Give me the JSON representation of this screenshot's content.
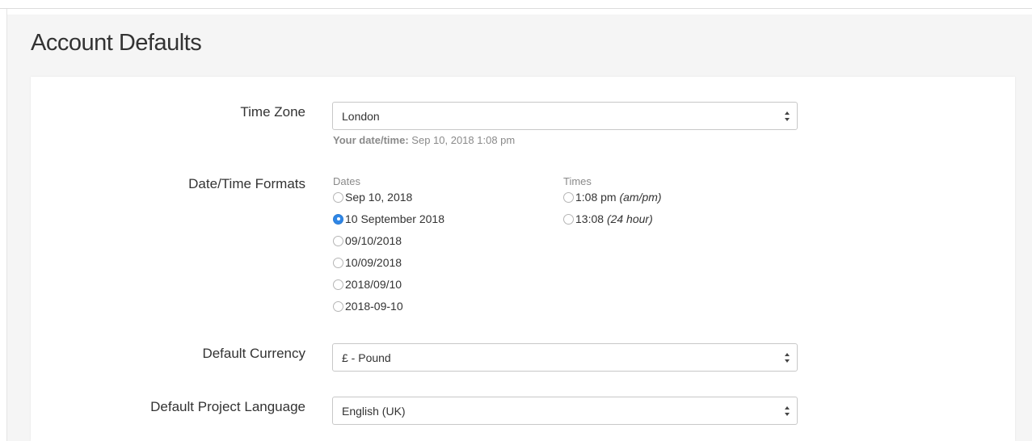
{
  "page": {
    "title": "Account Defaults"
  },
  "time_zone": {
    "label": "Time Zone",
    "selected": "London",
    "helper_label": "Your date/time:",
    "helper_value": "Sep 10, 2018 1:08 pm"
  },
  "date_time_formats": {
    "label": "Date/Time Formats",
    "dates": {
      "heading": "Dates",
      "options": [
        {
          "label": "Sep 10, 2018",
          "checked": false
        },
        {
          "label": "10 September 2018",
          "checked": true
        },
        {
          "label": "09/10/2018",
          "checked": false
        },
        {
          "label": "10/09/2018",
          "checked": false
        },
        {
          "label": "2018/09/10",
          "checked": false
        },
        {
          "label": "2018-09-10",
          "checked": false
        }
      ]
    },
    "times": {
      "heading": "Times",
      "options": [
        {
          "label": "1:08 pm",
          "note": "(am/pm)",
          "checked": false
        },
        {
          "label": "13:08",
          "note": "(24 hour)",
          "checked": false
        }
      ]
    }
  },
  "default_currency": {
    "label": "Default Currency",
    "selected": "£ - Pound"
  },
  "default_project_language": {
    "label": "Default Project Language",
    "selected": "English (UK)"
  },
  "colors": {
    "accent": "#2f86e6",
    "background": "#f5f5f5",
    "muted_text": "#8a8a8a"
  },
  "icons": {
    "select": "select-arrows-icon",
    "radio": "radio-icon"
  }
}
